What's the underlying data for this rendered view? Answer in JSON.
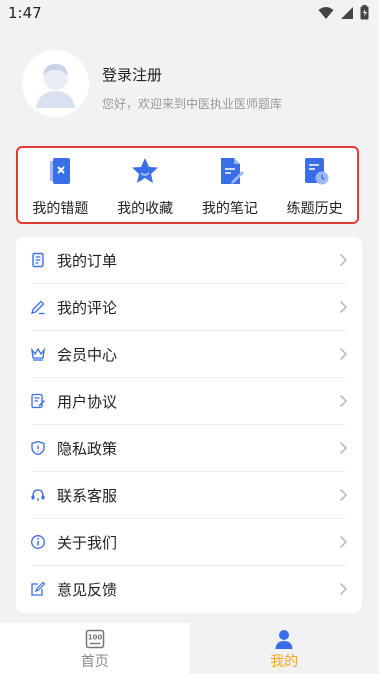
{
  "status_bar": {
    "time": "1:47",
    "icons": [
      "wifi-icon",
      "signal-icon",
      "battery-icon"
    ]
  },
  "profile": {
    "avatar_icon": "avatar-icon",
    "login_label": "登录注册",
    "welcome": "您好，欢迎来到中医执业医师题库"
  },
  "quick_actions": [
    {
      "label": "我的错题",
      "icon": "wrong-questions-icon"
    },
    {
      "label": "我的收藏",
      "icon": "star-icon"
    },
    {
      "label": "我的笔记",
      "icon": "notes-icon"
    },
    {
      "label": "练题历史",
      "icon": "history-icon"
    }
  ],
  "menu": [
    {
      "label": "我的订单",
      "icon": "order-icon"
    },
    {
      "label": "我的评论",
      "icon": "comment-icon"
    },
    {
      "label": "会员中心",
      "icon": "crown-icon"
    },
    {
      "label": "用户协议",
      "icon": "agreement-icon"
    },
    {
      "label": "隐私政策",
      "icon": "shield-icon"
    },
    {
      "label": "联系客服",
      "icon": "headset-icon"
    },
    {
      "label": "关于我们",
      "icon": "info-icon"
    },
    {
      "label": "意见反馈",
      "icon": "feedback-icon"
    }
  ],
  "tabbar": {
    "home_label": "首页",
    "home_icon_text": "100",
    "mine_label": "我的"
  },
  "colors": {
    "accent_blue": "#3a6ee8",
    "active_tab": "#f5a623",
    "highlight_border": "#e53935",
    "background": "#f2f2f4"
  }
}
